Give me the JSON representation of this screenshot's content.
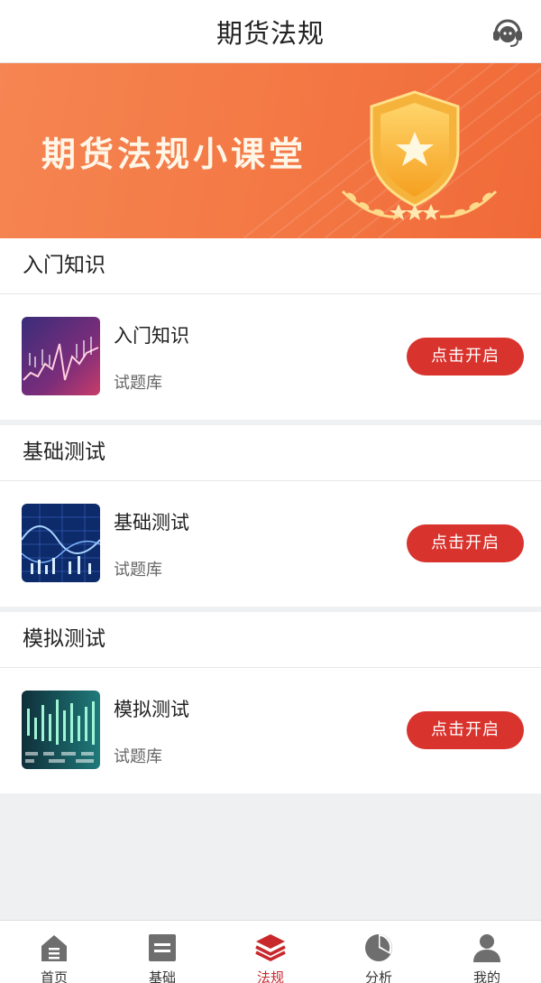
{
  "header": {
    "title": "期货法规",
    "support_icon": "headset-icon"
  },
  "banner": {
    "title": "期货法规小课堂",
    "badge_icon": "shield-star-badge-icon"
  },
  "sections": [
    {
      "heading": "入门知识",
      "item": {
        "name": "入门知识",
        "subtitle": "试题库",
        "button": "点击开启"
      }
    },
    {
      "heading": "基础测试",
      "item": {
        "name": "基础测试",
        "subtitle": "试题库",
        "button": "点击开启"
      }
    },
    {
      "heading": "模拟测试",
      "item": {
        "name": "模拟测试",
        "subtitle": "试题库",
        "button": "点击开启"
      }
    }
  ],
  "tabbar": {
    "active_index": 2,
    "active_color": "#c8282c",
    "tabs": [
      {
        "label": "首页",
        "icon": "home-icon"
      },
      {
        "label": "基础",
        "icon": "list-icon"
      },
      {
        "label": "法规",
        "icon": "layers-icon"
      },
      {
        "label": "分析",
        "icon": "pie-chart-icon"
      },
      {
        "label": "我的",
        "icon": "user-icon"
      }
    ]
  },
  "colors": {
    "accent_red": "#d9332e",
    "banner_orange": "#f47a46"
  }
}
